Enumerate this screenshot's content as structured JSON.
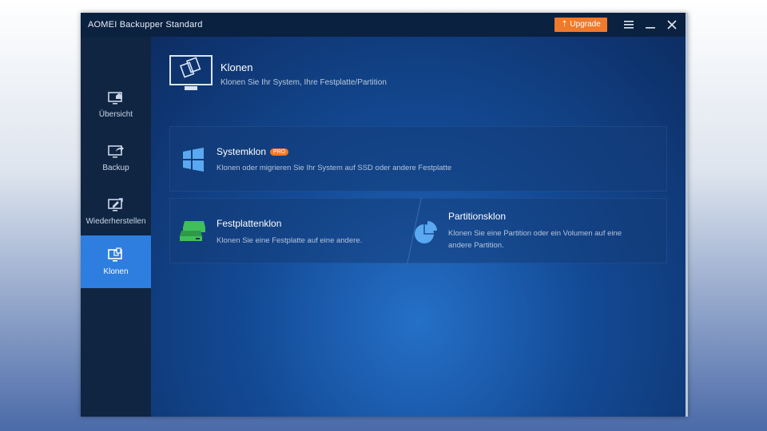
{
  "window": {
    "title": "AOMEI Backupper Standard"
  },
  "toolbar": {
    "upgrade_label": "Upgrade",
    "menu_icon": "hamburger-menu-icon",
    "minimize_icon": "minimize-icon",
    "close_icon": "close-icon"
  },
  "sidebar": {
    "items": [
      {
        "label": "Übersicht",
        "icon": "home-monitor-icon"
      },
      {
        "label": "Backup",
        "icon": "backup-monitor-icon"
      },
      {
        "label": "Wiederherstellen",
        "icon": "restore-monitor-icon"
      },
      {
        "label": "Klonen",
        "icon": "clone-monitor-icon",
        "active": true
      }
    ]
  },
  "main": {
    "title": "Klonen",
    "description": "Klonen Sie Ihr System, Ihre Festplatte/Partition",
    "cards": {
      "system": {
        "title": "Systemklon",
        "badge": "PRO",
        "description": "Klonen oder migrieren Sie Ihr System auf SSD oder andere Festplatte"
      },
      "disk": {
        "title": "Festplattenklon",
        "description": "Klonen Sie eine Festplatte auf eine andere."
      },
      "partition": {
        "title": "Partitionsklon",
        "description_line1": "Klonen Sie eine Partition oder ein Volumen auf eine",
        "description_line2": "andere Partition."
      }
    }
  },
  "colors": {
    "accent": "#f0792a",
    "active_nav": "#2e7ee0",
    "sidebar_bg": "#102542",
    "disk_icon_green": "#3fbf5a",
    "system_icon_blue": "#5aa9f0"
  }
}
